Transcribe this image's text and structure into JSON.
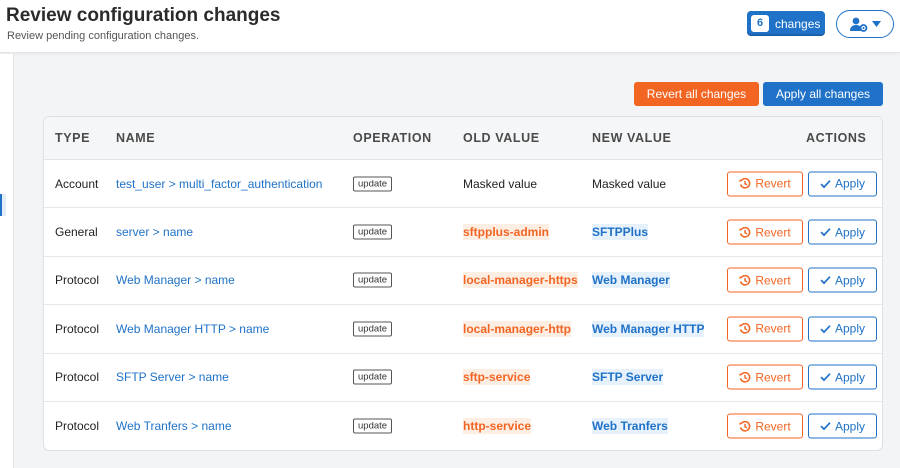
{
  "header": {
    "title": "Review configuration changes",
    "subtitle": "Review pending configuration changes.",
    "changes_count": "6",
    "changes_label": "changes"
  },
  "actions": {
    "revert_all_label": "Revert all changes",
    "apply_all_label": "Apply all changes"
  },
  "table": {
    "columns": {
      "type": "TYPE",
      "name": "NAME",
      "operation": "OPERATION",
      "old_value": "OLD VALUE",
      "new_value": "NEW VALUE",
      "actions": "ACTIONS"
    },
    "revert_label": "Revert",
    "apply_label": "Apply",
    "rows": [
      {
        "type": "Account",
        "name": "test_user > multi_factor_authentication",
        "operation": "update",
        "old_value": "Masked value",
        "new_value": "Masked value",
        "highlight": false
      },
      {
        "type": "General",
        "name": "server > name",
        "operation": "update",
        "old_value": "sftpplus-admin",
        "new_value": "SFTPPlus",
        "highlight": true
      },
      {
        "type": "Protocol",
        "name": "Web Manager > name",
        "operation": "update",
        "old_value": "local-manager-https",
        "new_value": "Web Manager",
        "highlight": true
      },
      {
        "type": "Protocol",
        "name": "Web Manager HTTP > name",
        "operation": "update",
        "old_value": "local-manager-http",
        "new_value": "Web Manager HTTP",
        "highlight": true
      },
      {
        "type": "Protocol",
        "name": "SFTP Server > name",
        "operation": "update",
        "old_value": "sftp-service",
        "new_value": "SFTP Server",
        "highlight": true
      },
      {
        "type": "Protocol",
        "name": "Web Tranfers > name",
        "operation": "update",
        "old_value": "http-service",
        "new_value": "Web Tranfers",
        "highlight": true
      }
    ]
  },
  "colors": {
    "primary": "#1f72c7",
    "danger": "#f26522"
  },
  "icons": {
    "user_menu": "user-gear-icon",
    "dropdown": "caret-down-icon",
    "revert": "history-icon",
    "apply": "check-icon"
  }
}
